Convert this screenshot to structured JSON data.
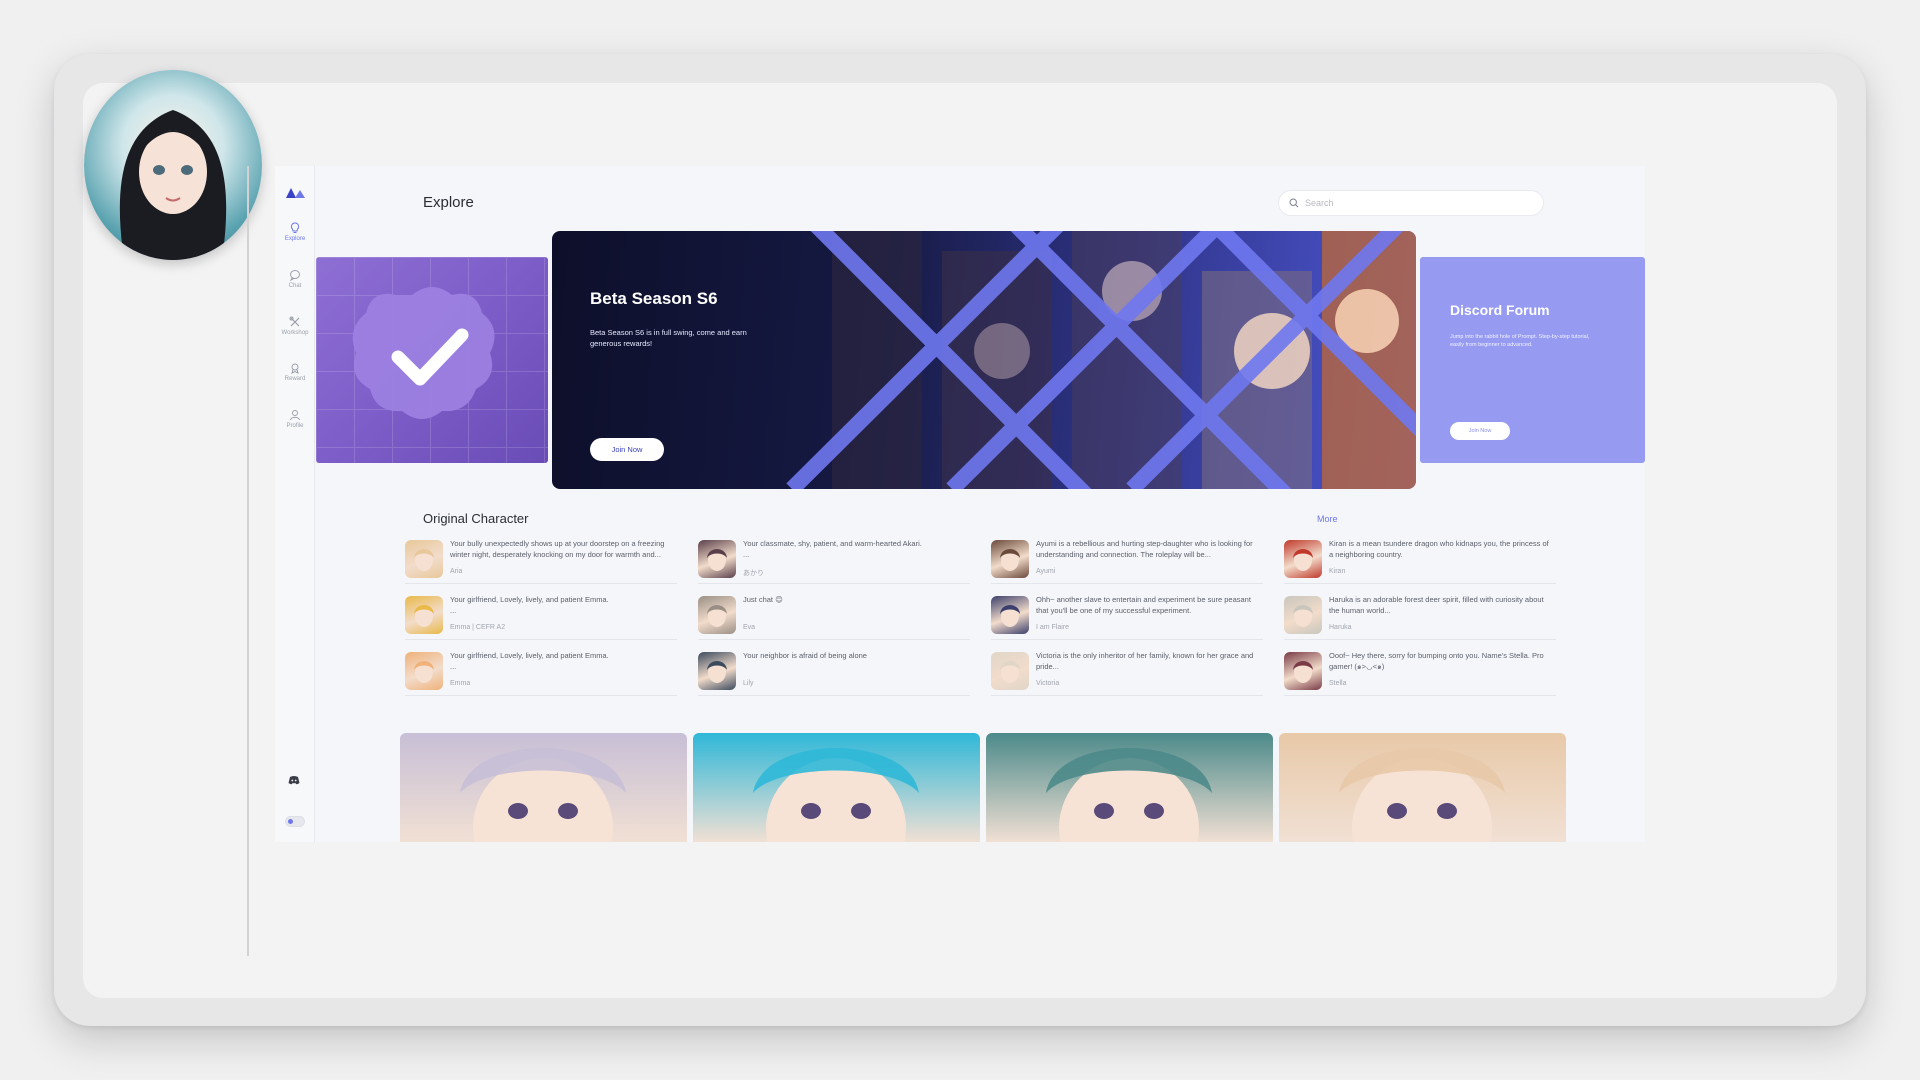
{
  "app": {
    "page_title": "Explore",
    "search_placeholder": "Search"
  },
  "sidebar": {
    "items": [
      {
        "label": "Explore",
        "icon": "lightbulb-icon",
        "active": true
      },
      {
        "label": "Chat",
        "icon": "chat-bubble-icon",
        "active": false
      },
      {
        "label": "Workshop",
        "icon": "tools-icon",
        "active": false
      },
      {
        "label": "Reward",
        "icon": "reward-icon",
        "active": false
      },
      {
        "label": "Profile",
        "icon": "user-icon",
        "active": false
      }
    ],
    "accent_color": "#6e78e8"
  },
  "carousel": {
    "main": {
      "title": "Beta Season S6",
      "description": "Beta Season S6 is in full swing, come and earn generous rewards!",
      "button": "Join Now"
    },
    "right": {
      "title": "Discord Forum",
      "description": "Jump into the rabbit hole of Prompt. Step-by-step tutorial, easily from beginner to advanced.",
      "button": "Join Now"
    }
  },
  "original_character": {
    "title": "Original Character",
    "more": "More",
    "items": [
      {
        "text": "Your bully unexpectedly shows up at your doorstep on a freezing winter night, desperately knocking on my door for warmth and...",
        "name": "Aria",
        "color": "#e8c89a"
      },
      {
        "text": "Your classmate, shy, patient, and warm-hearted Akari.\n...",
        "name": "あかり",
        "color": "#5a3f4a"
      },
      {
        "text": "Ayumi is a rebellious and hurting step-daughter who is looking for understanding and connection. The roleplay will be...",
        "name": "Ayumi",
        "color": "#6b4a3a"
      },
      {
        "text": "Kiran is a mean tsundere dragon who kidnaps you, the princess of a neighboring country.",
        "name": "Kiran",
        "color": "#c0392b"
      },
      {
        "text": "Your girlfriend, Lovely, lively, and patient Emma.\n...",
        "name": "Emma | CEFR A2",
        "color": "#e9b949"
      },
      {
        "text": "Just chat 😊",
        "name": "Eva",
        "color": "#9a8f86"
      },
      {
        "text": "Ohh~ another slave to entertain and experiment be sure peasant that you'll be one of my successful experiment.",
        "name": "I am Flaire",
        "color": "#3b3f6b"
      },
      {
        "text": "Haruka is an adorable forest deer spirit, filled with curiosity about the human world...",
        "name": "Haruka",
        "color": "#c9c6bd"
      },
      {
        "text": "Your girlfriend, Lovely, lively, and patient Emma.\n...",
        "name": "Emma",
        "color": "#f0b27a"
      },
      {
        "text": "Your neighbor is afraid of being alone",
        "name": "Lily",
        "color": "#3c4a5e"
      },
      {
        "text": "Victoria is the only inheritor of her family, known for her grace and pride...",
        "name": "Victoria",
        "color": "#e0d6c8"
      },
      {
        "text": "Ooof~ Hey there, sorry for bumping onto you. Name's Stella. Pro gamer! (๑>◡<๑)",
        "name": "Stella",
        "color": "#7a3b46"
      }
    ]
  },
  "gallery": [
    {
      "icon": "anime-portrait-silver-hair",
      "color": "#c7bfd6"
    },
    {
      "icon": "anime-portrait-orange-cat",
      "color": "#2fb8d8"
    },
    {
      "icon": "anime-portrait-pink-hair",
      "color": "#4c8a8a"
    },
    {
      "icon": "portrait-blonde-woman",
      "color": "#e8c9a8"
    }
  ]
}
